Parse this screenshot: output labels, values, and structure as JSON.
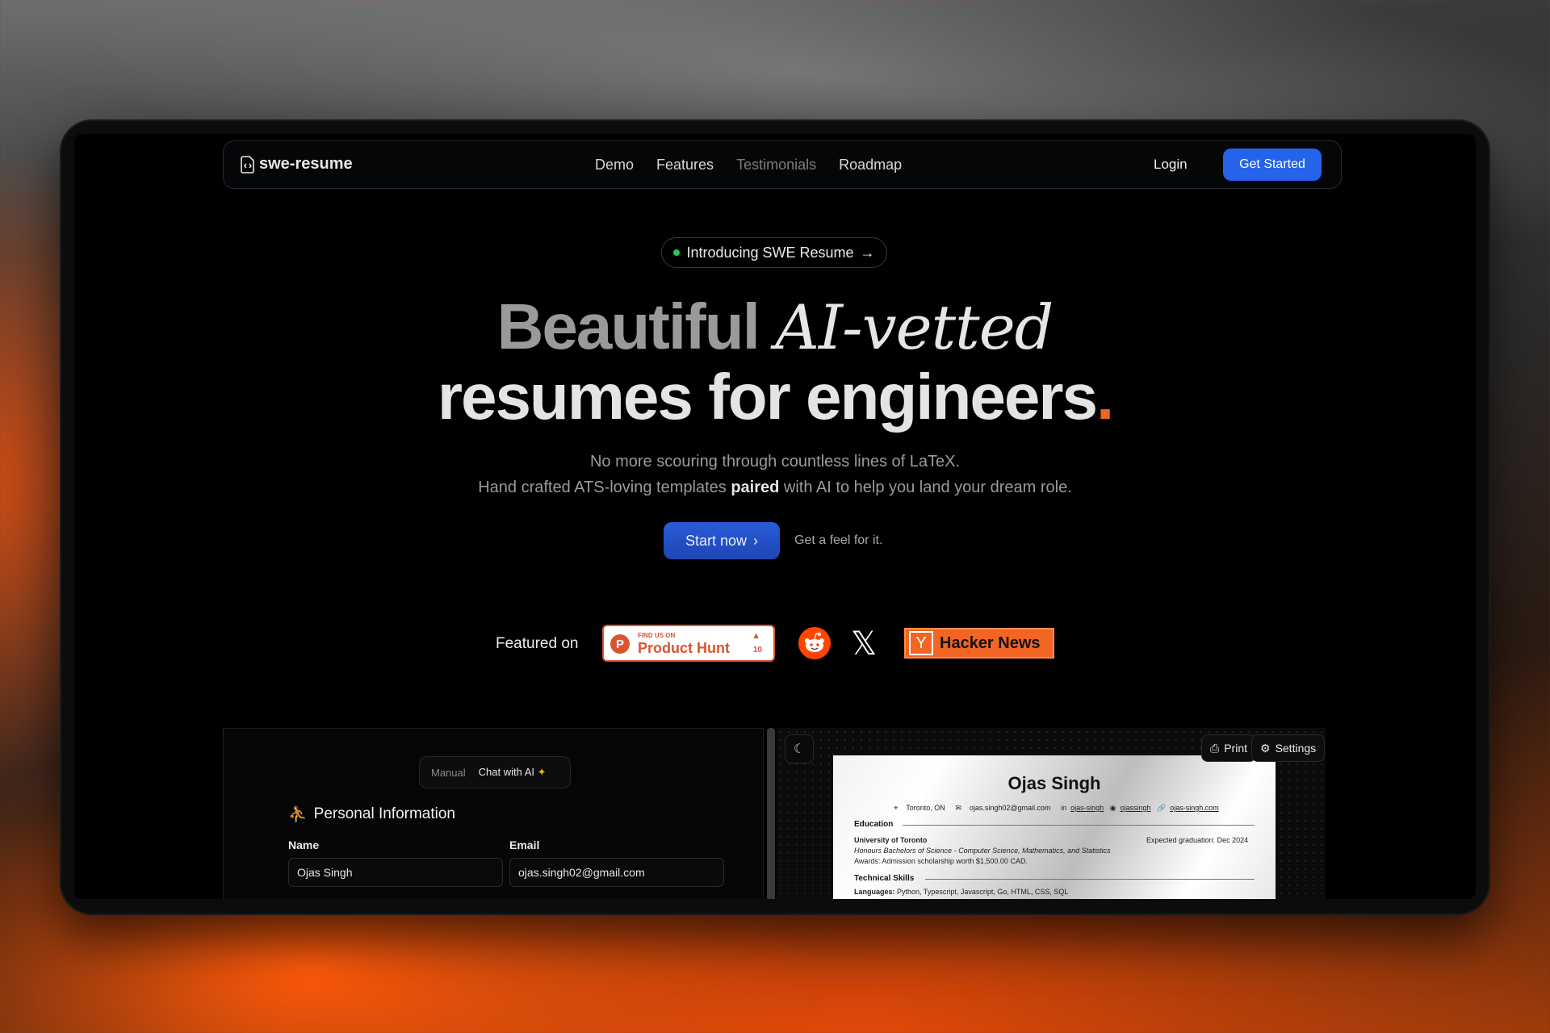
{
  "nav": {
    "logo": "swe-resume",
    "links": [
      "Demo",
      "Features",
      "Testimonials",
      "Roadmap"
    ],
    "login": "Login",
    "get_started": "Get Started"
  },
  "hero": {
    "pill": "Introducing SWE Resume",
    "headline_word1": "Beautiful",
    "headline_italic": "AI-vetted",
    "headline_line2": "resumes for engineers",
    "headline_dot": ".",
    "sub_line1": "No more scouring through countless lines of LaTeX.",
    "sub_line2_pre": "Hand crafted ATS-loving templates ",
    "sub_line2_bold": "paired",
    "sub_line2_post": " with AI to help you land your dream role.",
    "start_now": "Start now",
    "feel": "Get a feel for it."
  },
  "featured": {
    "label": "Featured on",
    "producthunt_small": "FIND US ON",
    "producthunt_big": "Product Hunt",
    "producthunt_votes": "10",
    "hackernews_y": "Y",
    "hackernews": "Hacker News",
    "icons": [
      "reddit-icon",
      "x-icon"
    ]
  },
  "editor": {
    "tab_manual": "Manual",
    "tab_chat": "Chat with AI",
    "section_title": "Personal Information",
    "name_label": "Name",
    "name_value": "Ojas Singh",
    "email_label": "Email",
    "email_value": "ojas.singh02@gmail.com"
  },
  "preview": {
    "print": "Print",
    "settings": "Settings",
    "resume": {
      "name": "Ojas Singh",
      "location": "Toronto, ON",
      "email": "ojas.singh02@gmail.com",
      "linkedin": "ojas-singh",
      "github": "ojassingh",
      "website": "ojas-singh.com",
      "education_heading": "Education",
      "university": "University of Toronto",
      "graduation": "Expected graduation: Dec 2024",
      "degree": "Honours Bachelors of Science - Computer Science, Mathematics, and Statistics",
      "awards": "Awards: Admission scholarship worth $1,500.00 CAD.",
      "skills_heading": "Technical Skills",
      "languages_label": "Languages:",
      "languages": "Python, Typescript, Javascript, Go, HTML, CSS, SQL"
    }
  },
  "colors": {
    "accent": "#2563eb",
    "orange_dot": "#ea6a1c",
    "producthunt": "#da552f",
    "reddit": "#ff4500",
    "hackernews": "#f26522"
  }
}
